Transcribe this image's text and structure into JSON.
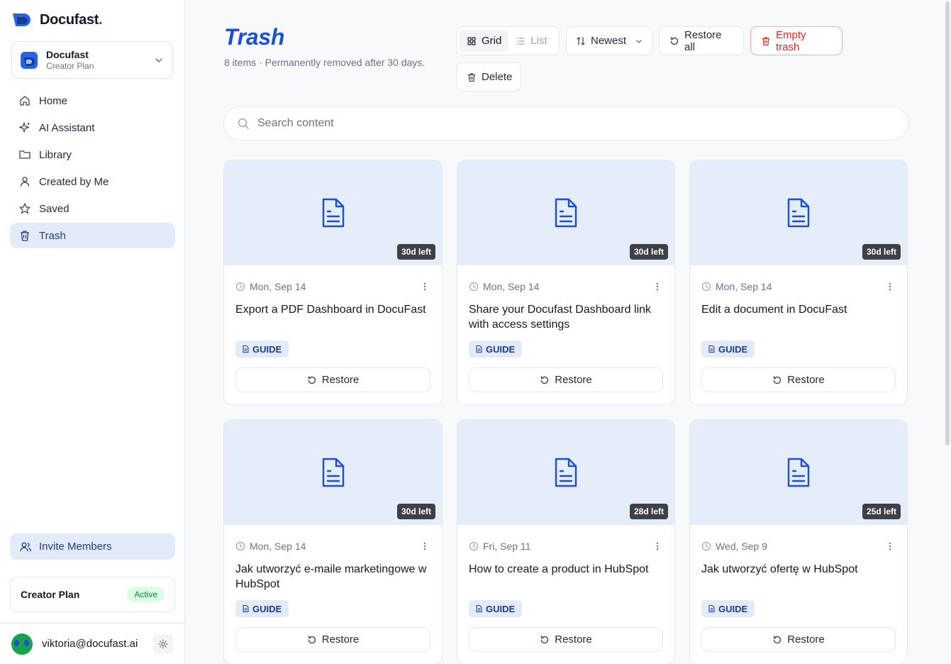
{
  "brand": {
    "name": "Docufast",
    "dot": "."
  },
  "workspace": {
    "name": "Docufast",
    "plan": "Creator Plan"
  },
  "nav": [
    {
      "label": "Home",
      "icon": "home-icon",
      "active": false
    },
    {
      "label": "AI Assistant",
      "icon": "sparkles-icon",
      "active": false
    },
    {
      "label": "Library",
      "icon": "folder-icon",
      "active": false
    },
    {
      "label": "Created by Me",
      "icon": "user-icon",
      "active": false
    },
    {
      "label": "Saved",
      "icon": "star-icon",
      "active": false
    },
    {
      "label": "Trash",
      "icon": "trash-icon",
      "active": true
    }
  ],
  "invite": {
    "label": "Invite Members"
  },
  "plan_card": {
    "name": "Creator Plan",
    "status": "Active"
  },
  "user": {
    "email": "viktoria@docufast.ai"
  },
  "page": {
    "title": "Trash",
    "subtitle": "8 items · Permanently removed after 30 days."
  },
  "toolbar": {
    "grid_label": "Grid",
    "list_label": "List",
    "sort_label": "Newest",
    "restore_all_label": "Restore all",
    "empty_trash_label": "Empty trash",
    "delete_label": "Delete"
  },
  "search": {
    "placeholder": "Search content",
    "value": ""
  },
  "cards": [
    {
      "days_left": "30d left",
      "date": "Mon, Sep 14",
      "title": "Export a PDF Dashboard in DocuFast",
      "tag": "GUIDE",
      "restore_label": "Restore"
    },
    {
      "days_left": "30d left",
      "date": "Mon, Sep 14",
      "title": "Share your Docufast Dashboard link with access settings",
      "tag": "GUIDE",
      "restore_label": "Restore"
    },
    {
      "days_left": "30d left",
      "date": "Mon, Sep 14",
      "title": "Edit a document in DocuFast",
      "tag": "GUIDE",
      "restore_label": "Restore"
    },
    {
      "days_left": "30d left",
      "date": "Mon, Sep 14",
      "title": "Jak utworzyć e-maile marketingowe w HubSpot",
      "tag": "GUIDE",
      "restore_label": "Restore"
    },
    {
      "days_left": "28d left",
      "date": "Fri, Sep 11",
      "title": "How to create a product in HubSpot",
      "tag": "GUIDE",
      "restore_label": "Restore"
    },
    {
      "days_left": "25d left",
      "date": "Wed, Sep 9",
      "title": "Jak utworzyć ofertę w HubSpot",
      "tag": "GUIDE",
      "restore_label": "Restore"
    }
  ],
  "colors": {
    "accent": "#1d4ed8",
    "active_bg": "#e3ebf9",
    "danger": "#dc2626",
    "success": "#15803d"
  }
}
